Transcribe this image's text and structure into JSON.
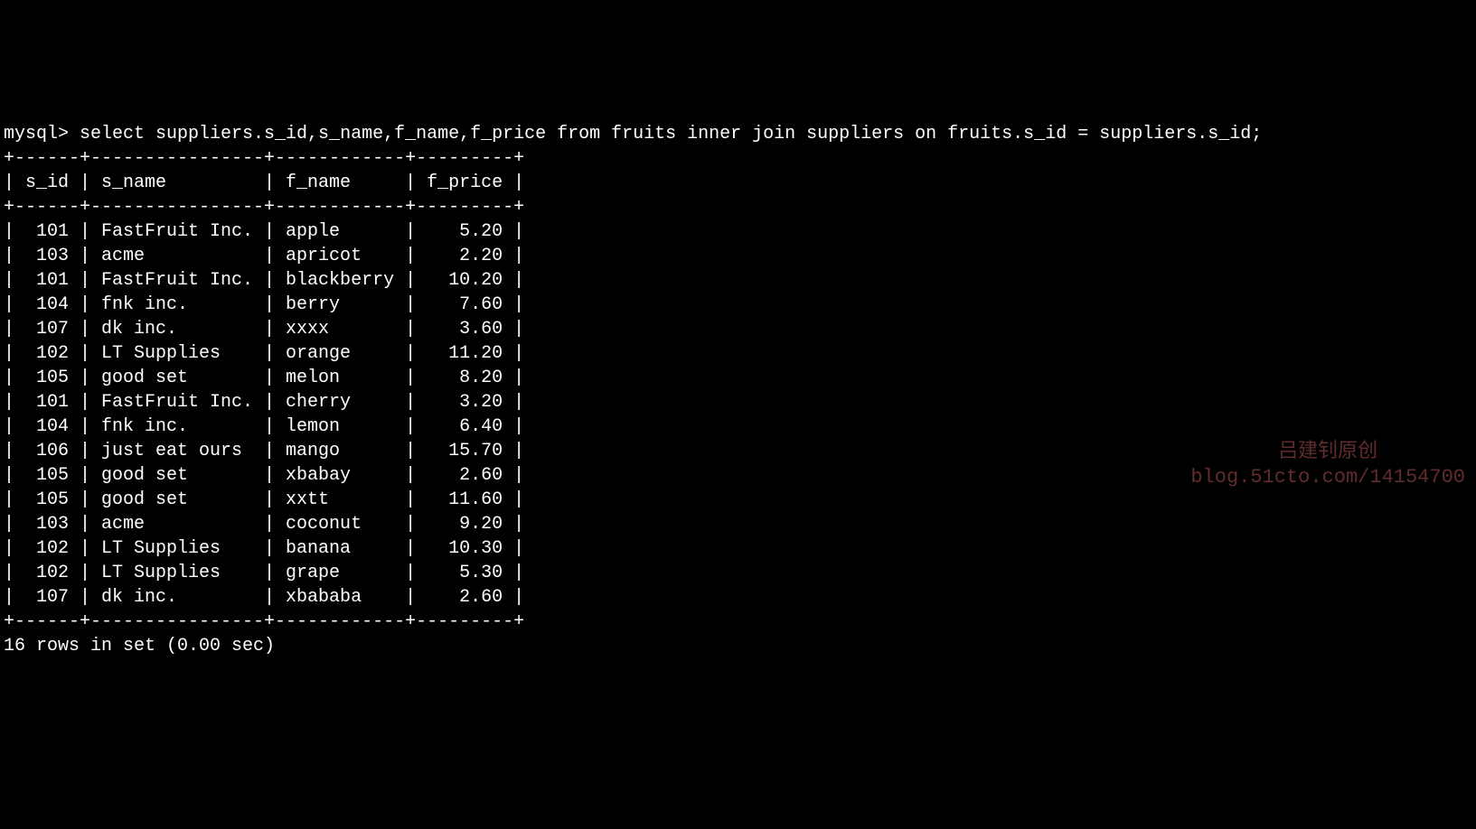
{
  "prompt": "mysql> ",
  "query": "select suppliers.s_id,s_name,f_name,f_price from fruits inner join suppliers on fruits.s_id = suppliers.s_id;",
  "columns": {
    "s_id": {
      "header": "s_id",
      "width": 6,
      "align": "right"
    },
    "s_name": {
      "header": "s_name",
      "width": 16,
      "align": "left"
    },
    "f_name": {
      "header": "f_name",
      "width": 12,
      "align": "left"
    },
    "f_price": {
      "header": "f_price",
      "width": 9,
      "align": "right"
    }
  },
  "rows": [
    {
      "s_id": "101",
      "s_name": "FastFruit Inc.",
      "f_name": "apple",
      "f_price": "5.20"
    },
    {
      "s_id": "103",
      "s_name": "acme",
      "f_name": "apricot",
      "f_price": "2.20"
    },
    {
      "s_id": "101",
      "s_name": "FastFruit Inc.",
      "f_name": "blackberry",
      "f_price": "10.20"
    },
    {
      "s_id": "104",
      "s_name": "fnk inc.",
      "f_name": "berry",
      "f_price": "7.60"
    },
    {
      "s_id": "107",
      "s_name": "dk inc.",
      "f_name": "xxxx",
      "f_price": "3.60"
    },
    {
      "s_id": "102",
      "s_name": "LT Supplies",
      "f_name": "orange",
      "f_price": "11.20"
    },
    {
      "s_id": "105",
      "s_name": "good set",
      "f_name": "melon",
      "f_price": "8.20"
    },
    {
      "s_id": "101",
      "s_name": "FastFruit Inc.",
      "f_name": "cherry",
      "f_price": "3.20"
    },
    {
      "s_id": "104",
      "s_name": "fnk inc.",
      "f_name": "lemon",
      "f_price": "6.40"
    },
    {
      "s_id": "106",
      "s_name": "just eat ours",
      "f_name": "mango",
      "f_price": "15.70"
    },
    {
      "s_id": "105",
      "s_name": "good set",
      "f_name": "xbabay",
      "f_price": "2.60"
    },
    {
      "s_id": "105",
      "s_name": "good set",
      "f_name": "xxtt",
      "f_price": "11.60"
    },
    {
      "s_id": "103",
      "s_name": "acme",
      "f_name": "coconut",
      "f_price": "9.20"
    },
    {
      "s_id": "102",
      "s_name": "LT Supplies",
      "f_name": "banana",
      "f_price": "10.30"
    },
    {
      "s_id": "102",
      "s_name": "LT Supplies",
      "f_name": "grape",
      "f_price": "5.30"
    },
    {
      "s_id": "107",
      "s_name": "dk inc.",
      "f_name": "xbababa",
      "f_price": "2.60"
    }
  ],
  "footer": "16 rows in set (0.00 sec)",
  "watermark": {
    "line1": "吕建钊原创",
    "line2": "blog.51cto.com/14154700"
  }
}
